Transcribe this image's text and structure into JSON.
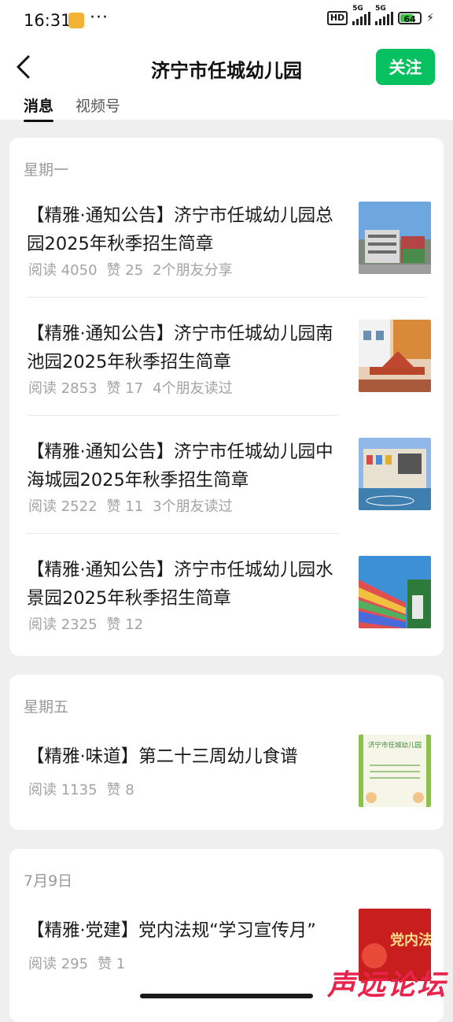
{
  "status": {
    "time": "16:31",
    "dots": "···",
    "hd": "HD",
    "net1": "5G",
    "net2": "5G",
    "battery": "64",
    "battery_level": 0.64
  },
  "header": {
    "title": "济宁市任城幼儿园",
    "follow_label": "关注"
  },
  "tabs": [
    {
      "label": "消息",
      "active": true
    },
    {
      "label": "视频号",
      "active": false
    }
  ],
  "groups": [
    {
      "day": "星期一",
      "items": [
        {
          "title": "【精雅·通知公告】济宁市任城幼儿园总园2025年秋季招生简章",
          "reads": "阅读 4050",
          "likes": "赞 25",
          "social": "2个朋友分享",
          "thumb": "school-building-photo"
        },
        {
          "title": "【精雅·通知公告】济宁市任城幼儿园南池园2025年秋季招生简章",
          "reads": "阅读 2853",
          "likes": "赞 17",
          "social": "4个朋友读过",
          "thumb": "playground-slide-photo"
        },
        {
          "title": "【精雅·通知公告】济宁市任城幼儿园中海城园2025年秋季招生简章",
          "reads": "阅读 2522",
          "likes": "赞 11",
          "social": "3个朋友读过",
          "thumb": "school-yard-photo"
        },
        {
          "title": "【精雅·通知公告】济宁市任城幼儿园水景园2025年秋季招生简章",
          "reads": "阅读 2325",
          "likes": "赞 12",
          "social": "",
          "thumb": "rainbow-wall-photo"
        }
      ]
    },
    {
      "day": "星期五",
      "items": [
        {
          "title": "【精雅·味道】第二十三周幼儿食谱",
          "reads": "阅读 1135",
          "likes": "赞 8",
          "social": "",
          "thumb": "menu-poster"
        }
      ]
    },
    {
      "day": "7月9日",
      "items": [
        {
          "title": "【精雅·党建】党内法规“学习宣传月”",
          "reads": "阅读 295",
          "likes": "赞 1",
          "social": "",
          "thumb": "party-poster"
        }
      ]
    }
  ],
  "thumb_text": {
    "menu": "济宁市任城幼儿园",
    "party": "党内法"
  },
  "watermark": "声远论坛",
  "colors": {
    "accent": "#07c160",
    "meta": "#a3a3a3",
    "day": "#9a9a9a"
  }
}
